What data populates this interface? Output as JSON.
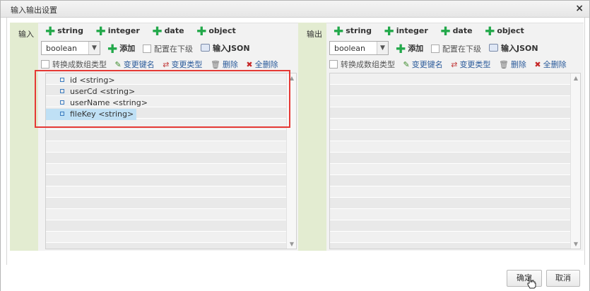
{
  "dialog": {
    "title": "输入输出设置",
    "close_label": "×"
  },
  "input": {
    "side_label": "输入",
    "types": [
      "string",
      "integer",
      "date",
      "object"
    ],
    "select_value": "boolean",
    "add_label": "添加",
    "checkbox_label": "配置在下级",
    "json_label": "输入JSON",
    "convert_label": "转换成数组类型",
    "rename_label": "变更键名",
    "change_type_label": "变更类型",
    "delete_label": "删除",
    "delete_all_label": "全删除",
    "fields": [
      "id <string>",
      "userCd <string>",
      "userName <string>",
      "fileKey <string>"
    ]
  },
  "output": {
    "side_label": "输出",
    "types": [
      "string",
      "integer",
      "date",
      "object"
    ],
    "select_value": "boolean",
    "add_label": "添加",
    "checkbox_label": "配置在下级",
    "json_label": "输入JSON",
    "convert_label": "转换成数组类型",
    "rename_label": "变更键名",
    "change_type_label": "变更类型",
    "delete_label": "删除",
    "delete_all_label": "全删除"
  },
  "footer": {
    "confirm_label": "确定",
    "cancel_label": "取消"
  },
  "colors": {
    "side_label_bg": "#e3ecd1",
    "plus_green": "#22a84a",
    "link_blue": "#2a5a9a",
    "highlight": "#e53935",
    "selected_row": "#bfe0f5"
  }
}
